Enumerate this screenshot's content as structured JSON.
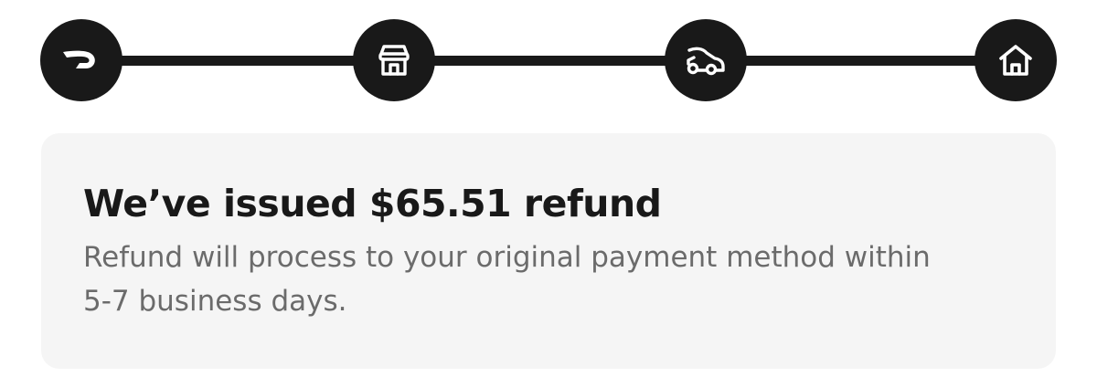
{
  "tracker": {
    "steps": [
      {
        "icon": "doordash-logo-icon",
        "state": "completed"
      },
      {
        "icon": "store-icon",
        "state": "completed"
      },
      {
        "icon": "car-icon",
        "state": "completed"
      },
      {
        "icon": "home-icon",
        "state": "completed"
      }
    ],
    "colors": {
      "step_fill": "#191919",
      "icon": "#ffffff",
      "track": "#191919"
    }
  },
  "refund_card": {
    "title": "We’ve issued $65.51 refund",
    "body": "Refund will process to your original payment method within 5-7 business days."
  },
  "colors": {
    "card_background": "#f5f5f5",
    "title_text": "#191919",
    "body_text": "#6b6b6b"
  }
}
